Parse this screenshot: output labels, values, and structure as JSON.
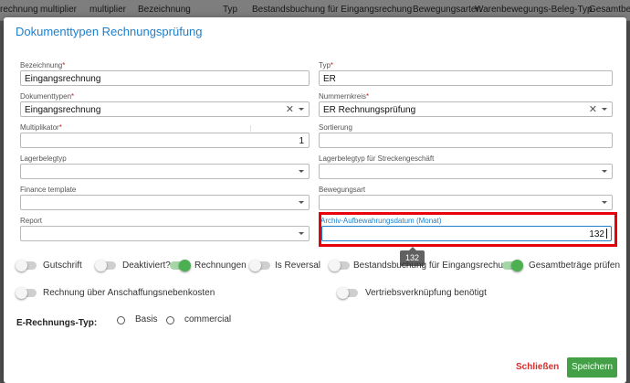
{
  "background_header": {
    "columns": [
      "rechnung",
      "multiplier",
      "multiplier",
      "Bezeichnung",
      "Typ",
      "Bestandsbuchung für Eingangsrechung",
      "Bewegungsarten",
      "Warenbewegungs-Beleg-Typ",
      "Gesamtbetr"
    ]
  },
  "modal": {
    "title": "Dokumenttypen Rechnungsprüfung",
    "fields": {
      "bezeichnung": {
        "label": "Bezeichnung",
        "required": "*",
        "value": "Eingangsrechnung"
      },
      "typ": {
        "label": "Typ",
        "required": "*",
        "value": "ER"
      },
      "dokumenttypen": {
        "label": "Dokumenttypen",
        "required": "*",
        "value": "Eingangsrechnung"
      },
      "nummernkreis": {
        "label": "Nummernkreis",
        "required": "*",
        "value": "ER Rechnungsprüfung"
      },
      "multiplikator": {
        "label": "Multiplikator",
        "required": "*",
        "value": "1"
      },
      "sortierung": {
        "label": "Sortierung",
        "value": ""
      },
      "lagerbelegtyp": {
        "label": "Lagerbelegtyp",
        "value": ""
      },
      "lagerbelegtyp_strecke": {
        "label": "Lagerbelegtyp für Streckengeschäft",
        "value": ""
      },
      "finance_template": {
        "label": "Finance template",
        "value": ""
      },
      "bewegungsart": {
        "label": "Bewegungsart",
        "value": ""
      },
      "report": {
        "label": "Report",
        "value": ""
      },
      "archiv": {
        "label": "Archiv-Aufbewahrungsdatum (Monat)",
        "value": "132"
      }
    },
    "tooltip": "132",
    "toggles": [
      {
        "label": "Gutschrift",
        "on": false
      },
      {
        "label": "Deaktiviert?",
        "on": false
      },
      {
        "label": "Rechnungen",
        "on": true
      },
      {
        "label": "Is Reversal",
        "on": false
      },
      {
        "label": "Bestandsbuchung für Eingangsrechung",
        "on": false
      },
      {
        "label": "Gesamtbeträge prüfen",
        "on": true
      },
      {
        "label": "Rechnung über Anschaffungsnebenkosten",
        "on": false
      },
      {
        "label": "Vertriebsverknüpfung benötigt",
        "on": false
      }
    ],
    "e_rechnungs_typ": {
      "label": "E-Rechnungs-Typ:",
      "options": [
        "Basis",
        "commercial"
      ]
    },
    "buttons": {
      "close": "Schließen",
      "save": "Speichern"
    },
    "colors": {
      "accent": "#1e7fc8",
      "save": "#43a047",
      "close": "#d32f2f",
      "highlight": "#e8000b",
      "toggle_on": "#4caf50"
    }
  }
}
